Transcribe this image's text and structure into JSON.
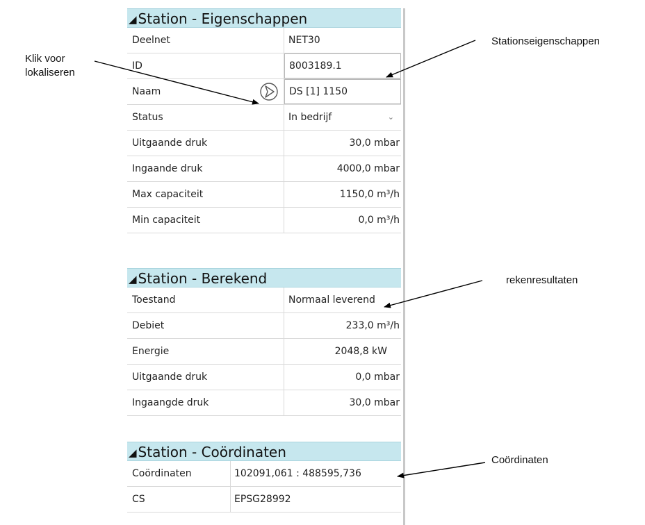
{
  "annotations": {
    "locate_line1": "Klik voor",
    "locate_line2": "lokaliseren",
    "properties": "Stationseigenschappen",
    "results": "rekenresultaten",
    "coordinates": "Coördinaten"
  },
  "sections": {
    "properties": {
      "title": "Station - Eigenschappen",
      "rows": [
        {
          "label": "Deelnet",
          "value": "NET30"
        },
        {
          "label": "ID",
          "value": "8003189.1"
        },
        {
          "label": "Naam",
          "value": "DS [1] 1150"
        },
        {
          "label": "Status",
          "value": "In bedrijf"
        },
        {
          "label": "Uitgaande druk",
          "value": "30,0 mbar"
        },
        {
          "label": "Ingaande druk",
          "value": "4000,0 mbar"
        },
        {
          "label": "Max capaciteit",
          "value": "1150,0 m³/h"
        },
        {
          "label": "Min capaciteit",
          "value": "0,0 m³/h"
        }
      ]
    },
    "calculated": {
      "title": "Station - Berekend",
      "rows": [
        {
          "label": "Toestand",
          "value": "Normaal leverend"
        },
        {
          "label": "Debiet",
          "value": "233,0 m³/h"
        },
        {
          "label": "Energie",
          "value": "2048,8 kW"
        },
        {
          "label": "Uitgaande druk",
          "value": "0,0 mbar"
        },
        {
          "label": "Ingaangde druk",
          "value": "30,0 mbar"
        }
      ]
    },
    "coordinates": {
      "title": "Station - Coördinaten",
      "rows": [
        {
          "label": "Coördinaten",
          "value": "102091,061 : 488595,736"
        },
        {
          "label": "CS",
          "value": "EPSG28992"
        }
      ]
    }
  },
  "colors": {
    "section_header_bg": "#c6e7ee",
    "grid_line": "#d9d9d9"
  },
  "icons": {
    "locate": "navigation-arrow-icon",
    "collapse": "collapse-triangle-icon",
    "dropdown": "chevron-down-icon"
  }
}
